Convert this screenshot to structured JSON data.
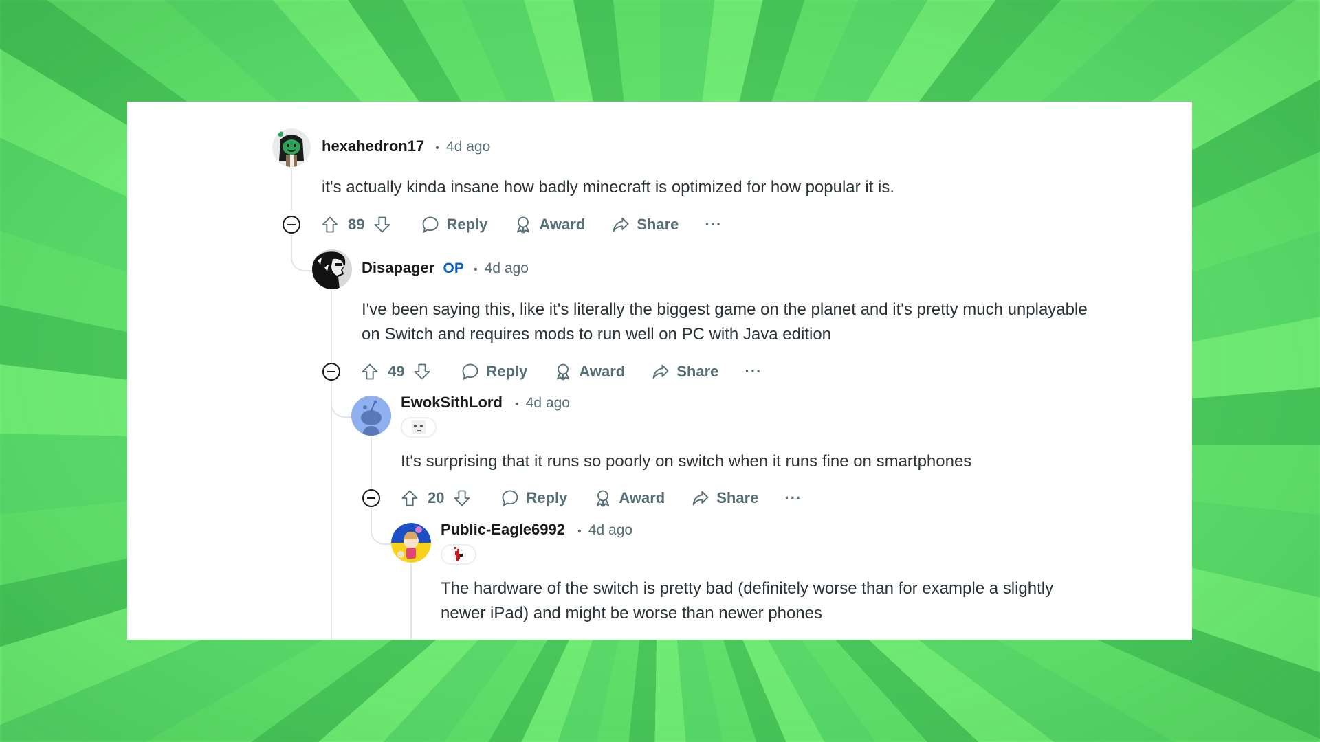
{
  "comments": [
    {
      "username": "hexahedron17",
      "is_op": false,
      "separator": "•",
      "timestamp": "4d ago",
      "avatar": "green-character-avatar",
      "body_lines": [
        "it's actually kinda insane how badly minecraft is optimized for how popular it is."
      ],
      "votes": "89",
      "actions": {
        "reply": "Reply",
        "award": "Award",
        "share": "Share",
        "more": "···"
      }
    },
    {
      "username": "Disapager",
      "is_op": true,
      "op_label": "OP",
      "separator": "•",
      "timestamp": "4d ago",
      "avatar": "black-white-portrait-avatar",
      "body_lines": [
        "I've been saying this, like it's literally the biggest game on the planet and it's pretty much unplayable",
        "on Switch and requires mods to run well on PC with Java edition"
      ],
      "votes": "49",
      "actions": {
        "reply": "Reply",
        "award": "Award",
        "share": "Share",
        "more": "···"
      }
    },
    {
      "username": "EwokSithLord",
      "is_op": false,
      "separator": "•",
      "timestamp": "4d ago",
      "avatar": "default-snoo-avatar",
      "flair": "face-emoji-flair",
      "body_lines": [
        "It's surprising that it runs so poorly on switch when it runs fine on smartphones"
      ],
      "votes": "20",
      "actions": {
        "reply": "Reply",
        "award": "Award",
        "share": "Share",
        "more": "···"
      }
    },
    {
      "username": "Public-Eagle6992",
      "is_op": false,
      "separator": "•",
      "timestamp": "4d ago",
      "avatar": "blue-yellow-snoo-avatar",
      "flair": "pixel-red-flair",
      "body_lines": [
        "The hardware of the switch is pretty bad (definitely worse than for example a slightly",
        "newer iPad) and might be worse than newer phones"
      ]
    }
  ],
  "colors": {
    "background_green": "#6ee776",
    "card": "#ffffff",
    "username": "#1a1a1b",
    "meta": "#576f76",
    "op_blue": "#0a5fc4",
    "body": "#2a3236",
    "thread_line": "#e2e5e7"
  }
}
